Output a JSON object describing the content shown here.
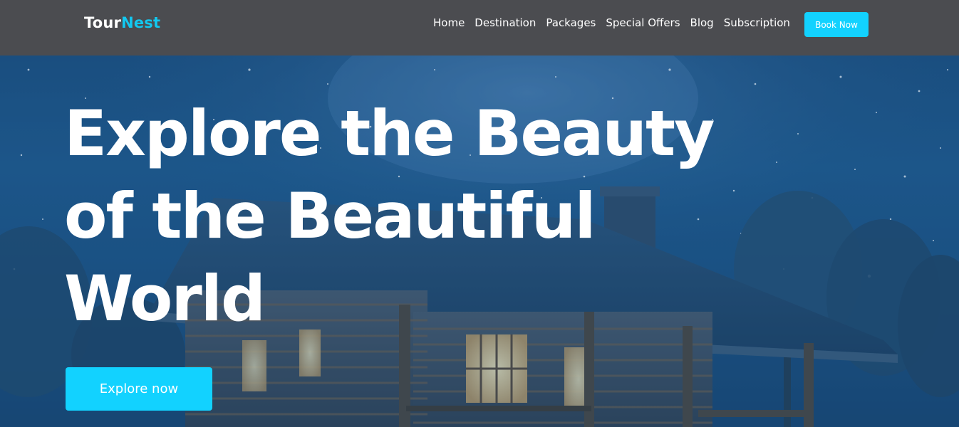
{
  "brand": {
    "part1": "Tour",
    "part2": "Nest"
  },
  "nav": {
    "items": [
      "Home",
      "Destination",
      "Packages",
      "Special Offers",
      "Blog",
      "Subscription"
    ],
    "cta": "Book Now"
  },
  "hero": {
    "headline": [
      "Explore the Beauty",
      "of the Beautiful",
      "World"
    ],
    "button": "Explore now"
  },
  "colors": {
    "accent": "#12d2ff",
    "header_bg": "#4b4c50",
    "logo_highlight": "#12c8f0"
  }
}
